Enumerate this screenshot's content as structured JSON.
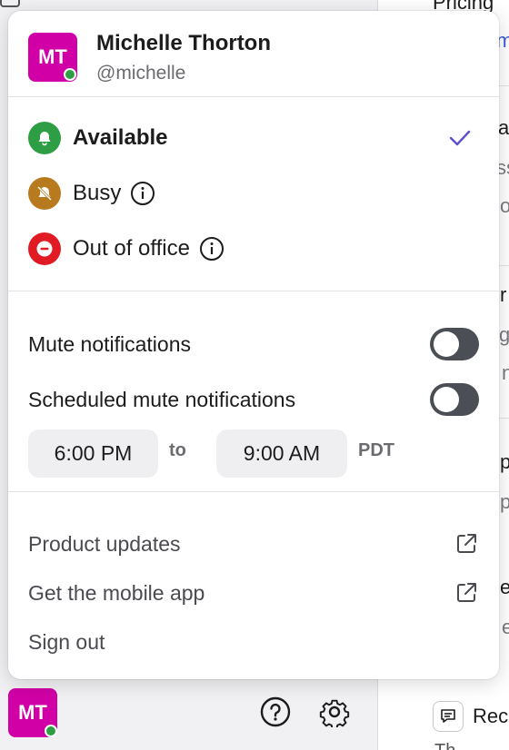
{
  "background": {
    "fragments": [
      "Pricing",
      "m",
      "a",
      "ss",
      "o",
      "r",
      "g",
      "n",
      "p",
      "p",
      "e",
      "e"
    ],
    "thread_label": "Rec",
    "thread_sub": "Th"
  },
  "bottom_bar": {
    "avatar_initials": "MT",
    "help_icon": "help-circle-icon",
    "settings_icon": "gear-icon"
  },
  "profile": {
    "initials": "MT",
    "name": "Michelle Thorton",
    "handle": "@michelle",
    "avatar_color": "#d000a6",
    "presence_color": "#2e9e44"
  },
  "statuses": [
    {
      "label": "Available",
      "icon": "bell-icon",
      "color": "#2e9e44",
      "selected": true
    },
    {
      "label": "Busy",
      "icon": "bell-off-icon",
      "color": "#b77a1f",
      "selected": false
    },
    {
      "label": "Out of office",
      "icon": "minus-circle-icon",
      "color": "#e01b24",
      "selected": false
    }
  ],
  "notifications": {
    "mute_label": "Mute notifications",
    "mute_on": false,
    "scheduled_label": "Scheduled mute notifications",
    "scheduled_on": false,
    "start_time": "6:00 PM",
    "to_label": "to",
    "end_time": "9:00 AM",
    "timezone": "PDT"
  },
  "links": [
    {
      "label": "Product updates",
      "external": true
    },
    {
      "label": "Get the mobile app",
      "external": true
    },
    {
      "label": "Sign out",
      "external": false
    }
  ],
  "colors": {
    "accent_check": "#5b4fd1",
    "toggle_off": "#4b4f55"
  }
}
